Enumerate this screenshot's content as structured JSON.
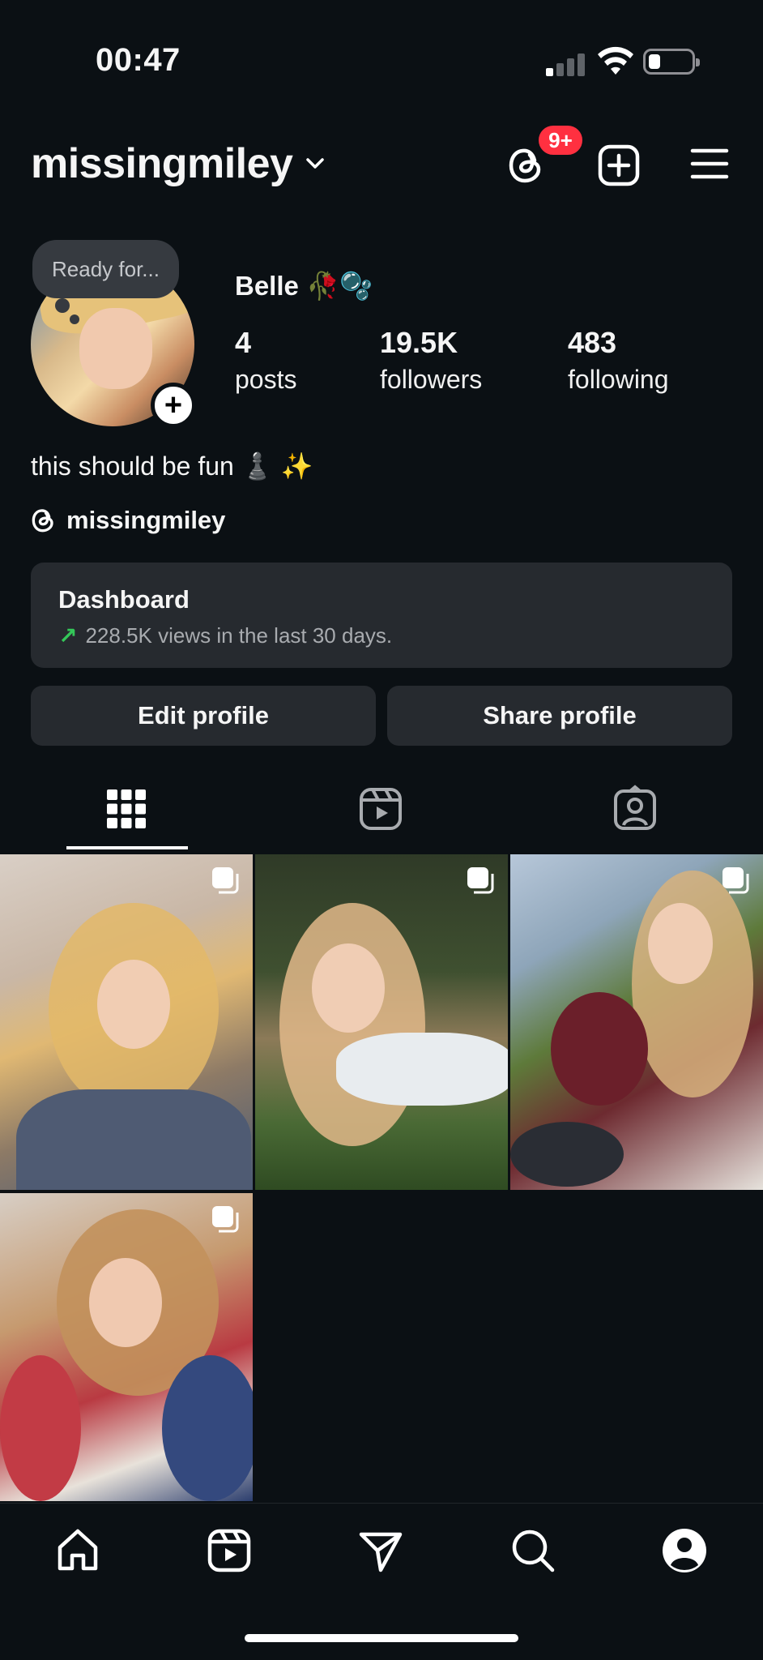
{
  "status_bar": {
    "time": "00:47"
  },
  "header": {
    "username": "missingmiley",
    "threads_badge": "9+"
  },
  "profile": {
    "note": "Ready for...",
    "display_name": "Belle 🥀🫧",
    "stats": [
      {
        "value": "4",
        "label": "posts"
      },
      {
        "value": "19.5K",
        "label": "followers"
      },
      {
        "value": "483",
        "label": "following"
      }
    ],
    "bio": "this should be fun ♟️ ✨",
    "threads_handle": "missingmiley"
  },
  "dashboard": {
    "title": "Dashboard",
    "subtitle": "228.5K views in the last 30 days."
  },
  "actions": {
    "edit_label": "Edit profile",
    "share_label": "Share profile"
  },
  "tabs": [
    "grid-icon",
    "reels-icon",
    "tagged-icon"
  ],
  "posts_grid": [
    {
      "type": "carousel"
    },
    {
      "type": "carousel"
    },
    {
      "type": "carousel"
    },
    {
      "type": "carousel"
    }
  ],
  "bottom_nav": [
    "home-icon",
    "reels-icon",
    "send-icon",
    "search-icon",
    "profile-icon"
  ],
  "colors": {
    "background": "#0b1014",
    "badge": "#ff3040",
    "trend_up": "#34c759",
    "surface": "#262a2f"
  }
}
